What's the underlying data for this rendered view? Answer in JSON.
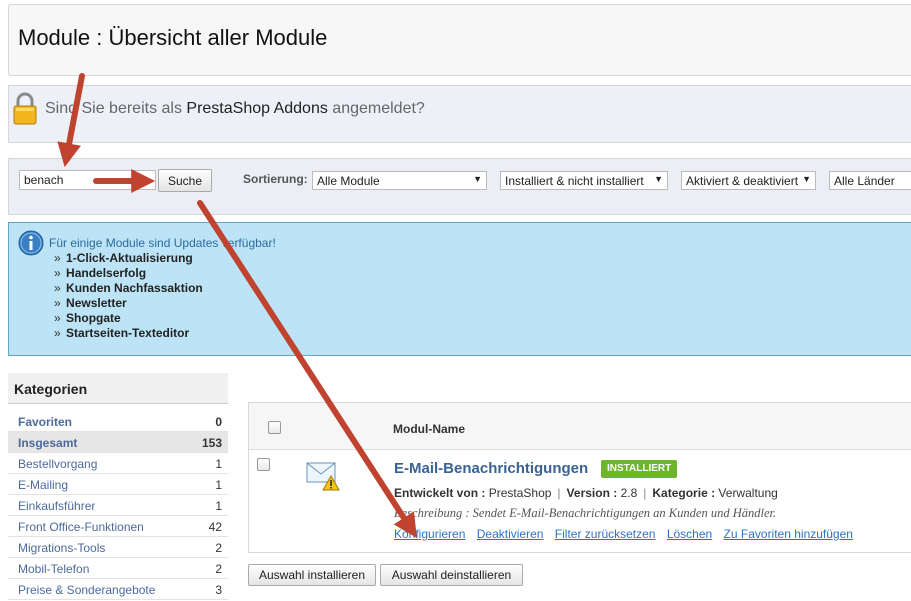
{
  "header": {
    "title": "Module : Übersicht aller Module"
  },
  "addons": {
    "text_before": "Sind Sie bereits als ",
    "brand": "PrestaShop Addons",
    "text_after": " angemeldet?"
  },
  "filters": {
    "search_value": "benach",
    "search_button": "Suche",
    "sort_label": "Sortierung:",
    "category_select": "Alle Module",
    "install_select": "Installiert & nicht installiert",
    "active_select": "Aktiviert & deaktiviert",
    "country_select": "Alle Länder"
  },
  "updates": {
    "title": "Für einige Module sind Updates verfügbar!",
    "items": [
      "1-Click-Aktualisierung",
      "Handelserfolg",
      "Kunden Nachfassaktion",
      "Newsletter",
      "Shopgate",
      "Startseiten-Texteditor"
    ]
  },
  "categories": {
    "title": "Kategorien",
    "items": [
      {
        "label": "Favoriten",
        "count": "0"
      },
      {
        "label": "Insgesamt",
        "count": "153"
      },
      {
        "label": "Bestellvorgang",
        "count": "1"
      },
      {
        "label": "E-Mailing",
        "count": "1"
      },
      {
        "label": "Einkaufsführer",
        "count": "1"
      },
      {
        "label": "Front Office-Funktionen",
        "count": "42"
      },
      {
        "label": "Migrations-Tools",
        "count": "2"
      },
      {
        "label": "Mobil-Telefon",
        "count": "2"
      },
      {
        "label": "Preise & Sonderangebote",
        "count": "3"
      }
    ]
  },
  "table": {
    "column_name": "Modul-Name",
    "module": {
      "name": "E-Mail-Benachrichtigungen",
      "badge": "INSTALLIERT",
      "developer_label": "Entwickelt von :",
      "developer": "PrestaShop",
      "version_label": "Version :",
      "version": "2.8",
      "category_label": "Kategorie :",
      "category": "Verwaltung",
      "description": "Beschreibung : Sendet E-Mail-Benachrichtigungen an Kunden und Händler.",
      "actions": [
        "Konfigurieren",
        "Deaktivieren",
        "Filter zurücksetzen",
        "Löschen",
        "Zu Favoriten hinzufügen"
      ]
    }
  },
  "bulk": {
    "install": "Auswahl installieren",
    "uninstall": "Auswahl deinstallieren"
  },
  "icons": [
    "lock-icon",
    "info-icon",
    "mail-warning-icon",
    "annotation-arrow"
  ],
  "colors": {
    "arrow": "#c0432f",
    "badge": "#6cb52d",
    "link": "#2a73c5",
    "info_bg": "#bce4f6"
  }
}
